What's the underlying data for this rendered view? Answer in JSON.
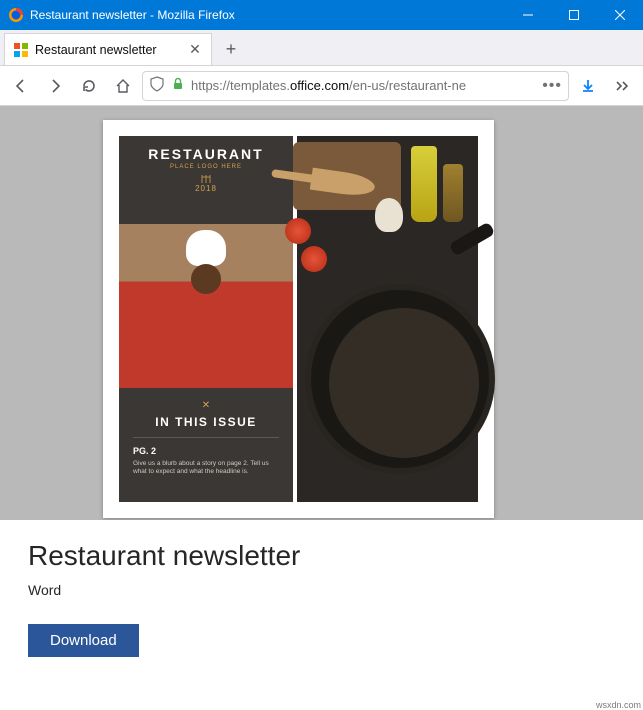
{
  "window": {
    "title": "Restaurant newsletter - Mozilla Firefox"
  },
  "tab": {
    "title": "Restaurant newsletter"
  },
  "url": {
    "protocol": "https://",
    "sub": "templates.",
    "domain": "office.com",
    "path": "/en-us/restaurant-ne"
  },
  "template": {
    "badge_title": "RESTAURANT",
    "badge_place": "PLACE LOGO HERE",
    "badge_year": "2018",
    "issue_heading": "IN THIS ISSUE",
    "issue_pg": "PG. 2",
    "issue_blurb": "Give us a blurb about a story on page 2. Tell us what to expect and what the headline is."
  },
  "details": {
    "title": "Restaurant newsletter",
    "app": "Word",
    "button": "Download"
  },
  "watermark": "wsxdn.com"
}
